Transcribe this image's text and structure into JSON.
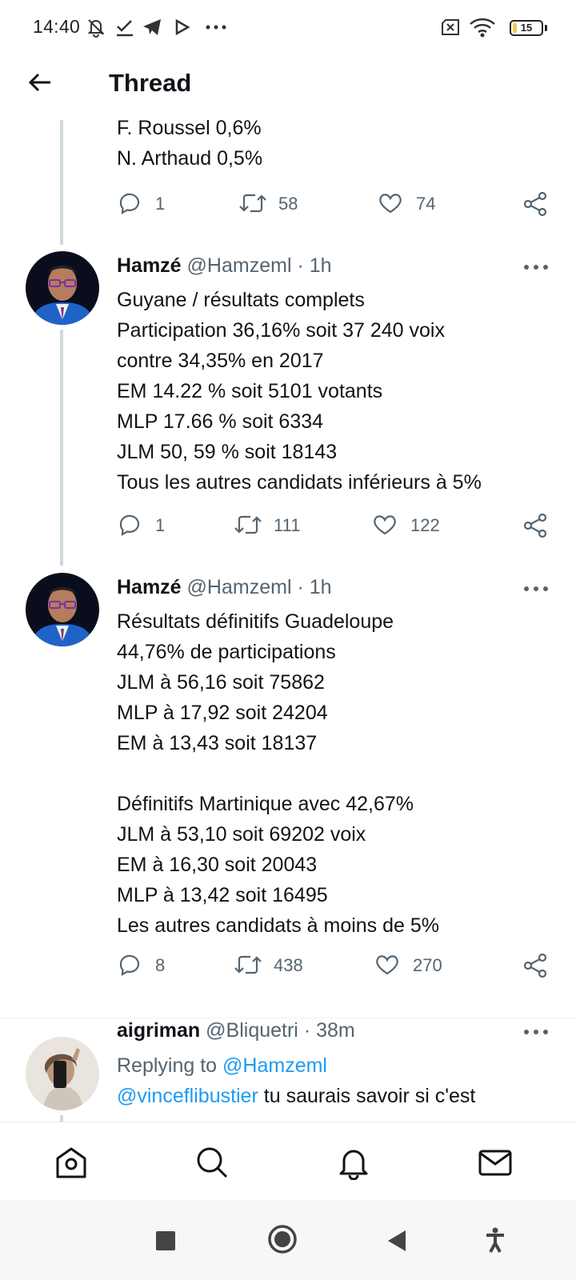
{
  "status_bar": {
    "time": "14:40",
    "battery": "15",
    "battery_level": 0.15,
    "icons": [
      "dnd-off-icon",
      "checkmark-icon",
      "telegram-icon",
      "play-icon",
      "more-icon",
      "no-sim-icon",
      "wifi-icon",
      "battery-icon"
    ]
  },
  "header": {
    "title": "Thread",
    "back_icon": "arrow-left-icon"
  },
  "tweets": [
    {
      "text": "F. Roussel 0,6%\nN. Arthaud 0,5%",
      "replies": "1",
      "retweets": "58",
      "likes": "74"
    },
    {
      "name": "Hamzé",
      "handle": "@Hamzeml",
      "time": "· 1h",
      "text": "Guyane / résultats complets\nParticipation 36,16% soit 37 240 voix\ncontre 34,35% en 2017\nEM 14.22 % soit 5101 votants\nMLP 17.66 % soit 6334\nJLM 50, 59 % soit 18143\nTous les autres candidats inférieurs à 5%",
      "replies": "1",
      "retweets": "111",
      "likes": "122"
    },
    {
      "name": "Hamzé",
      "handle": "@Hamzeml",
      "time": "· 1h",
      "text": "Résultats définitifs Guadeloupe\n44,76% de participations\nJLM à 56,16 soit 75862\nMLP à 17,92 soit 24204\nEM à 13,43 soit 18137\n\n Définitifs Martinique avec 42,67%\nJLM à 53,10 soit 69202 voix\nEM à 16,30 soit 20043\nMLP à 13,42 soit 16495\nLes autres candidats à moins de 5%",
      "replies": "8",
      "retweets": "438",
      "likes": "270"
    },
    {
      "name": "aigriman",
      "handle": "@Bliquetri",
      "time": "· 38m",
      "replying_prefix": "Replying to ",
      "replying_to": "@Hamzeml",
      "mention": "@vinceflibustier",
      "text_partial": " tu saurais savoir si c'est"
    }
  ],
  "bottom_nav": [
    "home-icon",
    "search-icon",
    "notifications-icon",
    "messages-icon"
  ],
  "system_nav": [
    "recents-square-icon",
    "home-circle-icon",
    "back-triangle-icon",
    "accessibility-icon"
  ],
  "colors": {
    "text": "#0f1419",
    "secondary": "#536471",
    "link": "#1d9bf0",
    "thread_line": "#cfd9de"
  }
}
